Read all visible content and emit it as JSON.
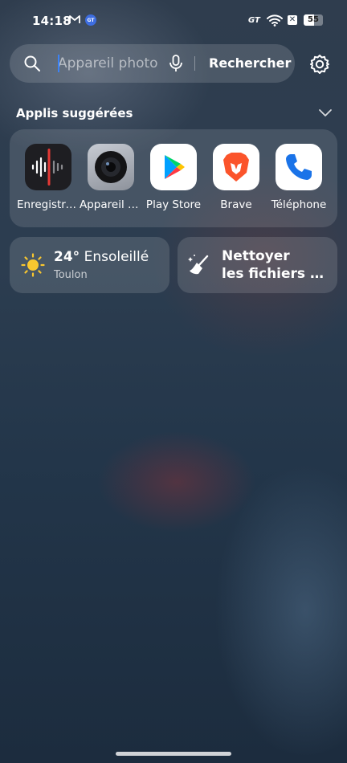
{
  "status_bar": {
    "time": "14:18",
    "gt_label": "GT",
    "xbox_mark": "✕",
    "battery_percent": 55,
    "battery_text": "55"
  },
  "search": {
    "placeholder": "Appareil photo",
    "button_label": "Rechercher"
  },
  "suggested": {
    "title": "Applis suggérées",
    "apps": [
      {
        "label": "Enregistreur",
        "icon": "voice-recorder-icon"
      },
      {
        "label": "Appareil photo",
        "icon": "camera-icon"
      },
      {
        "label": "Play Store",
        "icon": "play-store-icon"
      },
      {
        "label": "Brave",
        "icon": "brave-icon"
      },
      {
        "label": "Téléphone",
        "icon": "phone-icon"
      }
    ]
  },
  "weather": {
    "temperature": "24°",
    "condition": "Ensoleillé",
    "city": "Toulon"
  },
  "cleaner": {
    "line1": "Nettoyer",
    "line2": "les fichiers inutiles"
  },
  "colors": {
    "accent_blue": "#3b82f6",
    "recorder_red": "#e53935",
    "brave_orange": "#fb542b",
    "phone_blue": "#1a73e8"
  }
}
